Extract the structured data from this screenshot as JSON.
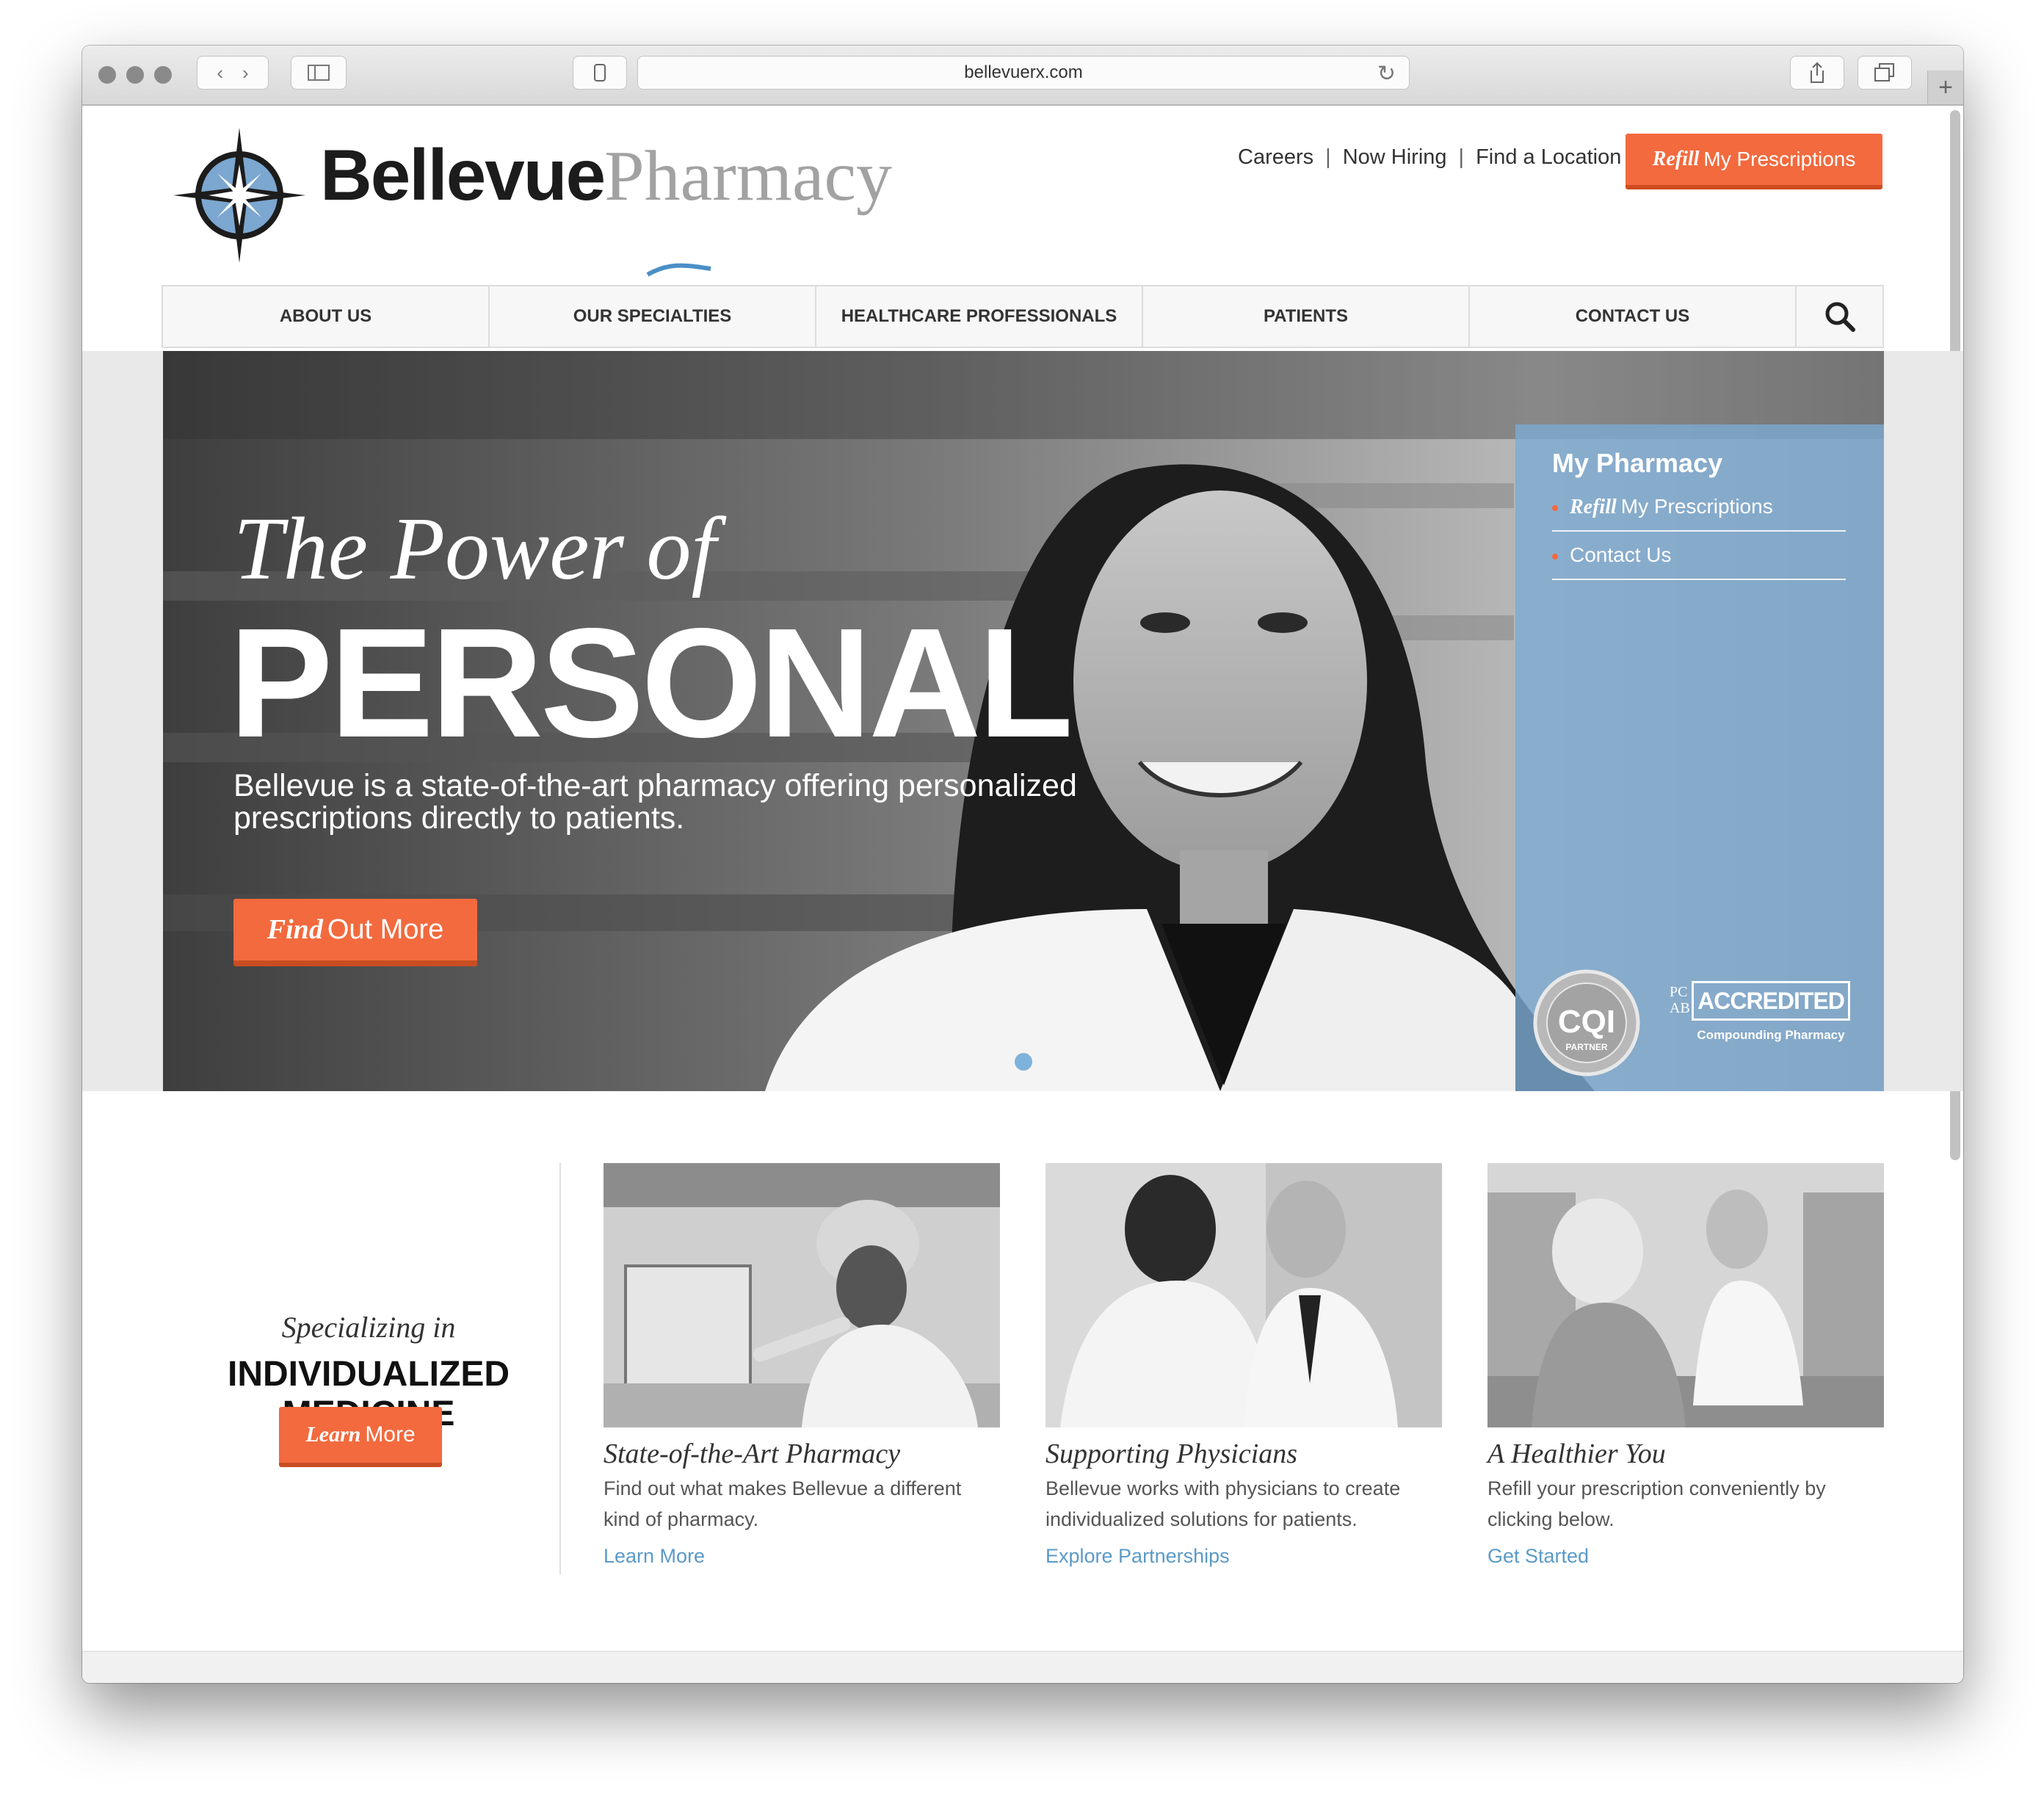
{
  "browser": {
    "url": "bellevuerx.com"
  },
  "logo": {
    "brand_bold": "Bellevue",
    "brand_light": "Pharmacy"
  },
  "top_links": [
    "Careers",
    "Now Hiring",
    "Find a Location"
  ],
  "top_links_separator": "|",
  "refill_button": {
    "italic": "Refill",
    "rest": "My Prescriptions"
  },
  "nav": {
    "items": [
      "ABOUT US",
      "OUR SPECIALTIES",
      "HEALTHCARE PROFESSIONALS",
      "PATIENTS",
      "CONTACT US"
    ],
    "search_icon": "search-icon"
  },
  "hero": {
    "script": "The Power of",
    "headline": "PERSONAL",
    "text": "Bellevue is a state-of-the-art pharmacy offering personalized prescriptions directly to patients.",
    "button": {
      "italic": "Find",
      "rest": "Out More"
    },
    "slides_total": 1,
    "active_slide": 1
  },
  "panel": {
    "title": "My Pharmacy",
    "links": [
      {
        "italic": "Refill",
        "rest": "My Prescriptions"
      },
      {
        "italic": "",
        "rest": "Contact Us"
      }
    ],
    "badges": {
      "cqi_main": "CQI",
      "cqi_sub": "PARTNER",
      "pcab": "PCAB",
      "accredited": "ACCREDITED",
      "accredited_sub": "Compounding Pharmacy"
    }
  },
  "specializing": {
    "script": "Specializing in",
    "line1": "INDIVIDUALIZED",
    "line2": "MEDICINE",
    "button": {
      "italic": "Learn",
      "rest": "More"
    }
  },
  "cards": [
    {
      "title": "State-of-the-Art Pharmacy",
      "text": "Find out what makes Bellevue a different kind of pharmacy.",
      "link": "Learn More"
    },
    {
      "title": "Supporting Physicians",
      "text": "Bellevue works with physicians to create individualized solutions for patients.",
      "link": "Explore Partnerships"
    },
    {
      "title": "A Healthier You",
      "text": "Refill your prescription conveniently by clicking below.",
      "link": "Get Started"
    }
  ],
  "colors": {
    "accent": "#f26a3e",
    "link": "#5b9ac8",
    "panel": "#7daad2",
    "text": "#333333"
  }
}
